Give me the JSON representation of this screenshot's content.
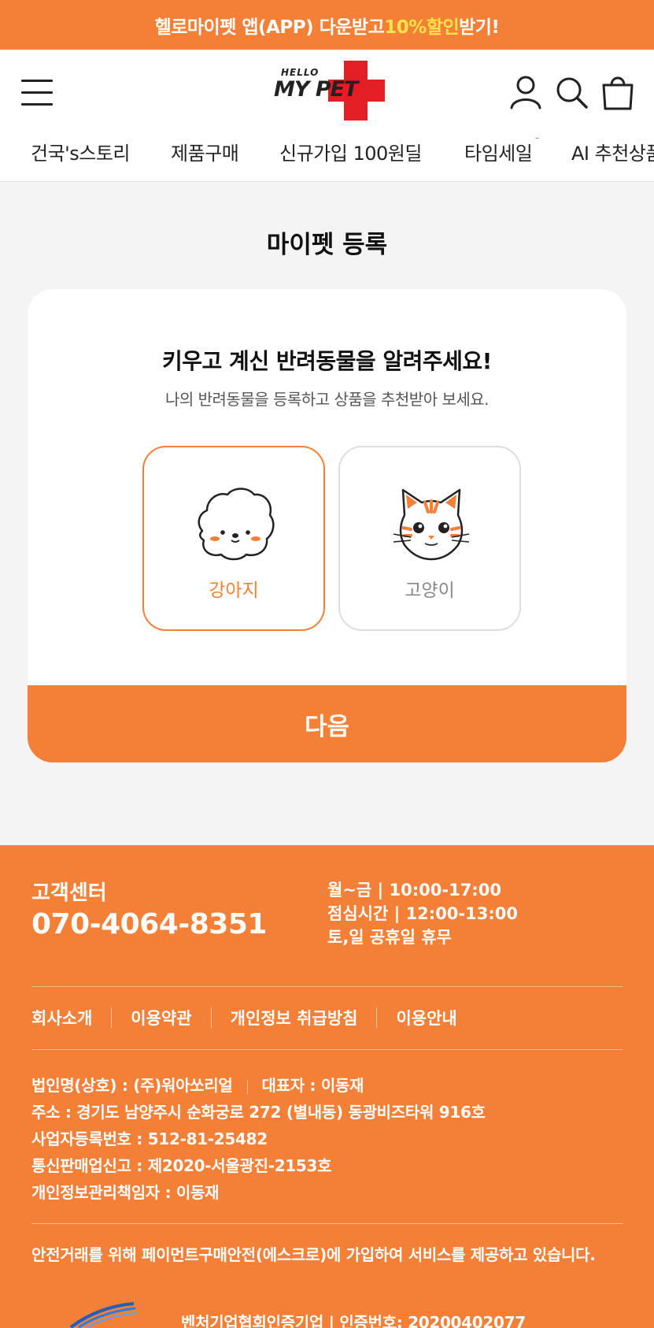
{
  "banner": {
    "text_before": "헬로마이펫 앱(APP) 다운받고",
    "text_highlight": "10%할인",
    "text_after": " 받기!"
  },
  "header": {
    "logo_small": "HELLO",
    "logo_main": "MY PET",
    "nav": [
      {
        "label": "건국's스토리"
      },
      {
        "label": "제품구매"
      },
      {
        "label": "신규가입 100원딜"
      },
      {
        "label": "타임세일"
      },
      {
        "label": "AI 추천상품"
      }
    ]
  },
  "page": {
    "title": "마이펫 등록"
  },
  "card": {
    "heading": "키우고 계신 반려동물을 알려주세요!",
    "subtext": "나의 반려동물을 등록하고 상품을 추천받아 보세요.",
    "options": [
      {
        "label": "강아지",
        "selected": true
      },
      {
        "label": "고양이",
        "selected": false
      }
    ],
    "next_label": "다음"
  },
  "footer": {
    "cs_title": "고객센터",
    "cs_phone": "070-4064-8351",
    "hours": [
      "월~금  |  10:00-17:00",
      "점심시간  |  12:00-13:00",
      "토,일 공휴일 휴무"
    ],
    "links": [
      "회사소개",
      "이용약관",
      "개인정보 취급방침",
      "이용안내"
    ],
    "company": {
      "corp_name": "법인명(상호) : (주)워아쏘리얼",
      "ceo": "대표자 : 이동재",
      "address": "주소 : 경기도 남양주시 순화궁로 272 (별내동) 동광비즈타워 916호",
      "biz_no": "사업자등록번호 : 512-81-25482",
      "ecommerce_no": "통신판매업신고 : 제2020-서울광진-2153호",
      "privacy_officer": "개인정보관리책임자 : 이동재"
    },
    "escrow": "안전거래를 위해 페이먼트구매안전(에스크로)에 가입하여 서비스를 제공하고 있습니다.",
    "venture": "벤처기업협회인증기업 | 인증번호: 20200402077"
  },
  "colors": {
    "accent": "#f47f36",
    "highlight": "#ffe34a",
    "logo_red": "#e31e24",
    "dot": "#ff4d6d"
  }
}
